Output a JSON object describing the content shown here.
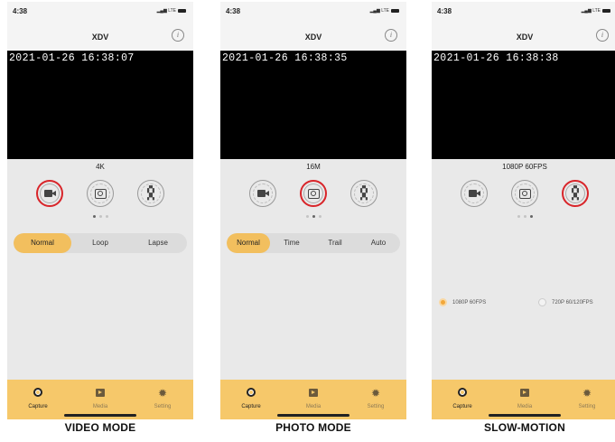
{
  "phones": [
    {
      "status_time": "4:38",
      "title": "XDV",
      "timestamp": "2021-01-26 16:38:07",
      "resolution": "4K",
      "active_mode": "video",
      "page_dots_active": 0,
      "modes": [
        "Normal",
        "Loop",
        "Lapse"
      ],
      "selected_mode": "Normal",
      "caption": "VIDEO MODE"
    },
    {
      "status_time": "4:38",
      "title": "XDV",
      "timestamp": "2021-01-26 16:38:35",
      "resolution": "16M",
      "active_mode": "photo",
      "page_dots_active": 1,
      "modes": [
        "Normal",
        "Time",
        "Trail",
        "Auto"
      ],
      "selected_mode": "Normal",
      "caption": "PHOTO MODE"
    },
    {
      "status_time": "4:38",
      "title": "XDV",
      "timestamp": "2021-01-26 16:38:38",
      "resolution": "1080P 60FPS",
      "active_mode": "slow-motion",
      "page_dots_active": 2,
      "radio_options": [
        {
          "label": "1080P 60FPS",
          "selected": true
        },
        {
          "label": "720P 60/120FPS",
          "selected": false
        }
      ],
      "caption": "SLOW-MOTION"
    }
  ],
  "tabbar": {
    "capture": "Capture",
    "media": "Media",
    "setting": "Setting"
  },
  "colors": {
    "accent": "#f6c86a",
    "selected_segment": "#f2bf5e",
    "active_ring": "#d9252a"
  }
}
